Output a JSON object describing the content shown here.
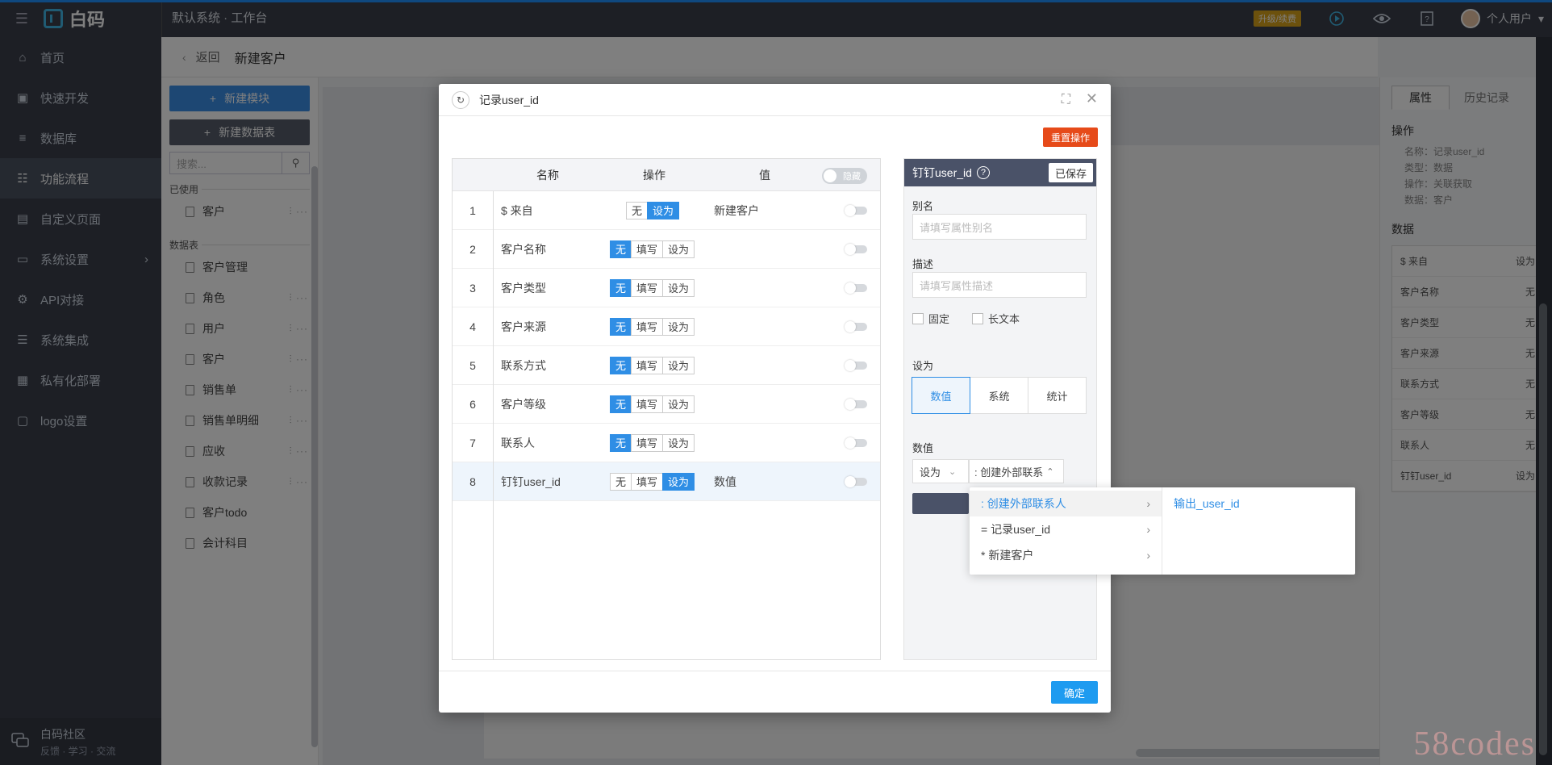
{
  "topbar": {
    "brand": "白码",
    "system": "默认系统 · 工作台",
    "upgrade": "升级/续费",
    "user": "个人用户"
  },
  "sidebar": {
    "items": [
      {
        "label": "首页",
        "icon": "home-icon"
      },
      {
        "label": "快速开发",
        "icon": "cube-icon"
      },
      {
        "label": "数据库",
        "icon": "database-icon"
      },
      {
        "label": "功能流程",
        "icon": "flow-icon",
        "active": true
      },
      {
        "label": "自定义页面",
        "icon": "page-icon"
      },
      {
        "label": "系统设置",
        "icon": "monitor-icon",
        "has_submenu": true
      },
      {
        "label": "API对接",
        "icon": "api-icon"
      },
      {
        "label": "系统集成",
        "icon": "layers-icon"
      },
      {
        "label": "私有化部署",
        "icon": "deploy-icon"
      },
      {
        "label": "logo设置",
        "icon": "logo-icon"
      }
    ],
    "community_title": "白码社区",
    "community_sub": "反馈 · 学习 · 交流"
  },
  "crumb": {
    "back": "返回",
    "title": "新建客户"
  },
  "leftpane": {
    "btn_module": "新建模块",
    "btn_table": "新建数据表",
    "search_placeholder": "搜索...",
    "used_label": "已使用",
    "used_items": [
      "客户"
    ],
    "tables_label": "数据表",
    "tables": [
      "客户管理",
      "角色",
      "用户",
      "客户",
      "销售单",
      "销售单明细",
      "应收",
      "收款记录",
      "客户todo",
      "会计科目"
    ]
  },
  "rightpane": {
    "tab_props": "属性",
    "tab_history": "历史记录",
    "op_label": "操作",
    "op_name": "名称：记录user_id",
    "op_type": "类型：数据",
    "op_action": "操作：关联获取",
    "op_data": "数据：客户",
    "data_label": "数据",
    "rows": [
      {
        "k": "$ 来自",
        "v": "设为"
      },
      {
        "k": "客户名称",
        "v": "无"
      },
      {
        "k": "客户类型",
        "v": "无"
      },
      {
        "k": "客户来源",
        "v": "无"
      },
      {
        "k": "联系方式",
        "v": "无"
      },
      {
        "k": "客户等级",
        "v": "无"
      },
      {
        "k": "联系人",
        "v": "无"
      },
      {
        "k": "钉钉user_id",
        "v": "设为"
      }
    ]
  },
  "dialog": {
    "title": "记录user_id",
    "reset": "重置操作",
    "ok": "确定",
    "grid": {
      "h_name": "名称",
      "h_op": "操作",
      "h_val": "值",
      "h_toggle": "隐藏",
      "rows": [
        {
          "num": "1",
          "name": "$ 来自",
          "val": "新建客户"
        },
        {
          "num": "2",
          "name": "客户名称",
          "val": ""
        },
        {
          "num": "3",
          "name": "客户类型",
          "val": ""
        },
        {
          "num": "4",
          "name": "客户来源",
          "val": ""
        },
        {
          "num": "5",
          "name": "联系方式",
          "val": ""
        },
        {
          "num": "6",
          "name": "客户等级",
          "val": ""
        },
        {
          "num": "7",
          "name": "联系人",
          "val": ""
        },
        {
          "num": "8",
          "name": "钉钉user_id",
          "val": "数值"
        }
      ],
      "op_none": "无",
      "op_fill": "填写",
      "op_set": "设为"
    },
    "panel": {
      "title": "钉钉user_id",
      "saved": "已保存",
      "alias_label": "别名",
      "alias_placeholder": "请填写属性别名",
      "desc_label": "描述",
      "desc_placeholder": "请填写属性描述",
      "fixed": "固定",
      "longtext": "长文本",
      "setas_label": "设为",
      "seg": [
        "数值",
        "系统",
        "统计"
      ],
      "value_label": "数值",
      "sel_a": "设为",
      "sel_b": ": 创建外部联系"
    },
    "cascader": {
      "col1": [
        ": 创建外部联系人",
        "= 记录user_id",
        "* 新建客户"
      ],
      "col2": [
        "输出_user_id"
      ]
    }
  },
  "watermark": "58codes"
}
